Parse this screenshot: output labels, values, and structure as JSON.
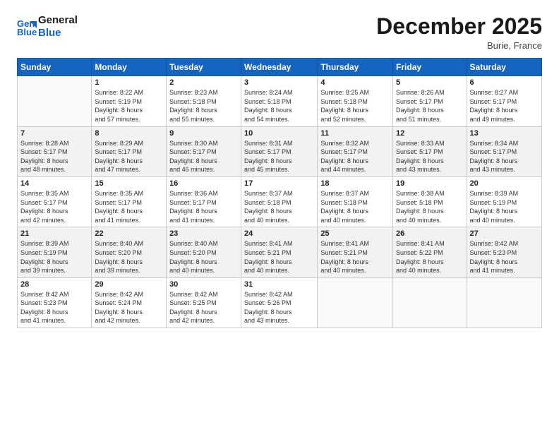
{
  "logo": {
    "line1": "General",
    "line2": "Blue"
  },
  "title": "December 2025",
  "location": "Burie, France",
  "headers": [
    "Sunday",
    "Monday",
    "Tuesday",
    "Wednesday",
    "Thursday",
    "Friday",
    "Saturday"
  ],
  "weeks": [
    [
      {
        "day": "",
        "info": ""
      },
      {
        "day": "1",
        "info": "Sunrise: 8:22 AM\nSunset: 5:19 PM\nDaylight: 8 hours\nand 57 minutes."
      },
      {
        "day": "2",
        "info": "Sunrise: 8:23 AM\nSunset: 5:18 PM\nDaylight: 8 hours\nand 55 minutes."
      },
      {
        "day": "3",
        "info": "Sunrise: 8:24 AM\nSunset: 5:18 PM\nDaylight: 8 hours\nand 54 minutes."
      },
      {
        "day": "4",
        "info": "Sunrise: 8:25 AM\nSunset: 5:18 PM\nDaylight: 8 hours\nand 52 minutes."
      },
      {
        "day": "5",
        "info": "Sunrise: 8:26 AM\nSunset: 5:17 PM\nDaylight: 8 hours\nand 51 minutes."
      },
      {
        "day": "6",
        "info": "Sunrise: 8:27 AM\nSunset: 5:17 PM\nDaylight: 8 hours\nand 49 minutes."
      }
    ],
    [
      {
        "day": "7",
        "info": "Sunrise: 8:28 AM\nSunset: 5:17 PM\nDaylight: 8 hours\nand 48 minutes."
      },
      {
        "day": "8",
        "info": "Sunrise: 8:29 AM\nSunset: 5:17 PM\nDaylight: 8 hours\nand 47 minutes."
      },
      {
        "day": "9",
        "info": "Sunrise: 8:30 AM\nSunset: 5:17 PM\nDaylight: 8 hours\nand 46 minutes."
      },
      {
        "day": "10",
        "info": "Sunrise: 8:31 AM\nSunset: 5:17 PM\nDaylight: 8 hours\nand 45 minutes."
      },
      {
        "day": "11",
        "info": "Sunrise: 8:32 AM\nSunset: 5:17 PM\nDaylight: 8 hours\nand 44 minutes."
      },
      {
        "day": "12",
        "info": "Sunrise: 8:33 AM\nSunset: 5:17 PM\nDaylight: 8 hours\nand 43 minutes."
      },
      {
        "day": "13",
        "info": "Sunrise: 8:34 AM\nSunset: 5:17 PM\nDaylight: 8 hours\nand 43 minutes."
      }
    ],
    [
      {
        "day": "14",
        "info": "Sunrise: 8:35 AM\nSunset: 5:17 PM\nDaylight: 8 hours\nand 42 minutes."
      },
      {
        "day": "15",
        "info": "Sunrise: 8:35 AM\nSunset: 5:17 PM\nDaylight: 8 hours\nand 41 minutes."
      },
      {
        "day": "16",
        "info": "Sunrise: 8:36 AM\nSunset: 5:17 PM\nDaylight: 8 hours\nand 41 minutes."
      },
      {
        "day": "17",
        "info": "Sunrise: 8:37 AM\nSunset: 5:18 PM\nDaylight: 8 hours\nand 40 minutes."
      },
      {
        "day": "18",
        "info": "Sunrise: 8:37 AM\nSunset: 5:18 PM\nDaylight: 8 hours\nand 40 minutes."
      },
      {
        "day": "19",
        "info": "Sunrise: 8:38 AM\nSunset: 5:18 PM\nDaylight: 8 hours\nand 40 minutes."
      },
      {
        "day": "20",
        "info": "Sunrise: 8:39 AM\nSunset: 5:19 PM\nDaylight: 8 hours\nand 40 minutes."
      }
    ],
    [
      {
        "day": "21",
        "info": "Sunrise: 8:39 AM\nSunset: 5:19 PM\nDaylight: 8 hours\nand 39 minutes."
      },
      {
        "day": "22",
        "info": "Sunrise: 8:40 AM\nSunset: 5:20 PM\nDaylight: 8 hours\nand 39 minutes."
      },
      {
        "day": "23",
        "info": "Sunrise: 8:40 AM\nSunset: 5:20 PM\nDaylight: 8 hours\nand 40 minutes."
      },
      {
        "day": "24",
        "info": "Sunrise: 8:41 AM\nSunset: 5:21 PM\nDaylight: 8 hours\nand 40 minutes."
      },
      {
        "day": "25",
        "info": "Sunrise: 8:41 AM\nSunset: 5:21 PM\nDaylight: 8 hours\nand 40 minutes."
      },
      {
        "day": "26",
        "info": "Sunrise: 8:41 AM\nSunset: 5:22 PM\nDaylight: 8 hours\nand 40 minutes."
      },
      {
        "day": "27",
        "info": "Sunrise: 8:42 AM\nSunset: 5:23 PM\nDaylight: 8 hours\nand 41 minutes."
      }
    ],
    [
      {
        "day": "28",
        "info": "Sunrise: 8:42 AM\nSunset: 5:23 PM\nDaylight: 8 hours\nand 41 minutes."
      },
      {
        "day": "29",
        "info": "Sunrise: 8:42 AM\nSunset: 5:24 PM\nDaylight: 8 hours\nand 42 minutes."
      },
      {
        "day": "30",
        "info": "Sunrise: 8:42 AM\nSunset: 5:25 PM\nDaylight: 8 hours\nand 42 minutes."
      },
      {
        "day": "31",
        "info": "Sunrise: 8:42 AM\nSunset: 5:26 PM\nDaylight: 8 hours\nand 43 minutes."
      },
      {
        "day": "",
        "info": ""
      },
      {
        "day": "",
        "info": ""
      },
      {
        "day": "",
        "info": ""
      }
    ]
  ]
}
